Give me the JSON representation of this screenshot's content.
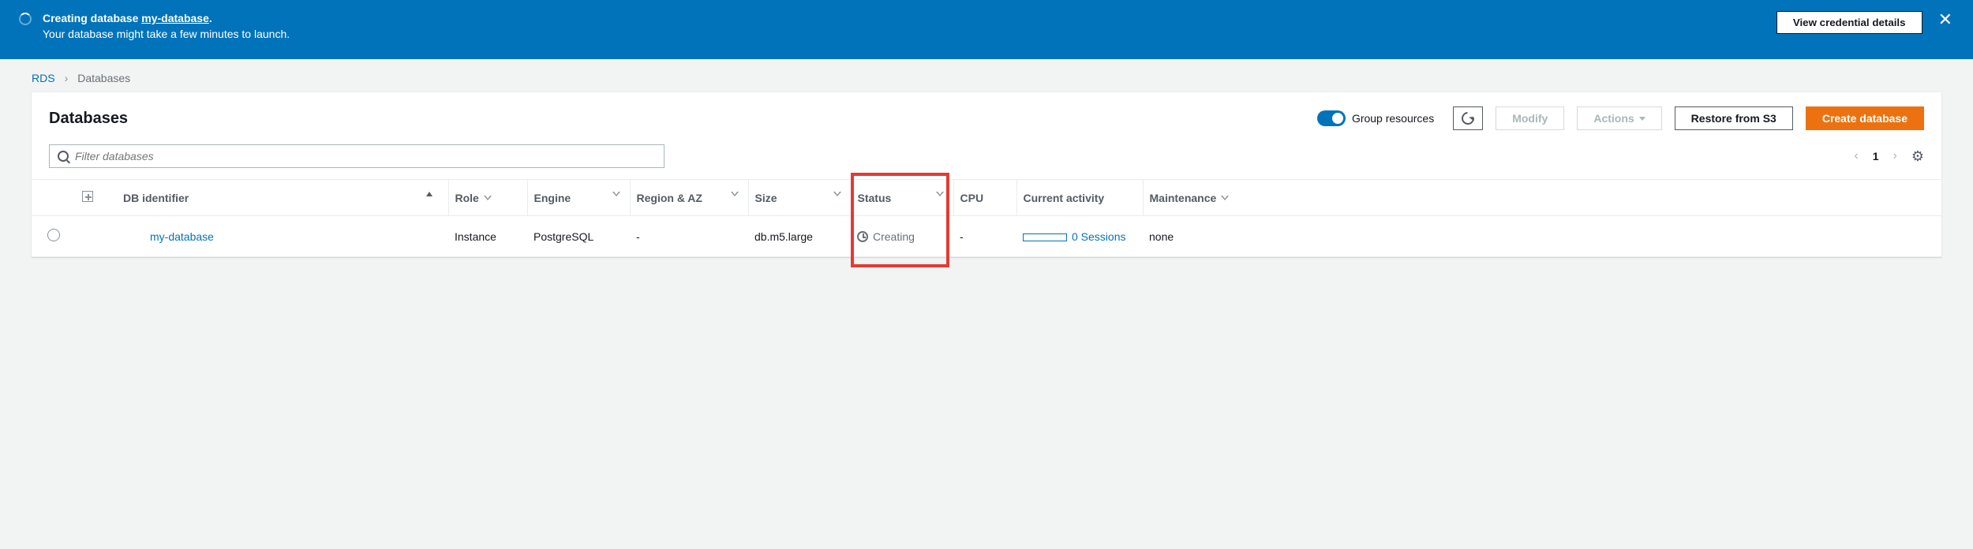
{
  "notification": {
    "line1_prefix": "Creating database ",
    "db_link": "my-database",
    "line1_suffix": ".",
    "line2": "Your database might take a few minutes to launch.",
    "view_credentials": "View credential details"
  },
  "breadcrumb": {
    "root": "RDS",
    "current": "Databases"
  },
  "panel": {
    "title": "Databases",
    "toggle_label": "Group resources",
    "modify": "Modify",
    "actions": "Actions",
    "restore": "Restore from S3",
    "create": "Create database",
    "filter_placeholder": "Filter databases",
    "page": "1"
  },
  "columns": {
    "identifier": "DB identifier",
    "role": "Role",
    "engine": "Engine",
    "region": "Region & AZ",
    "size": "Size",
    "status": "Status",
    "cpu": "CPU",
    "activity": "Current activity",
    "maintenance": "Maintenance"
  },
  "row": {
    "identifier": "my-database",
    "role": "Instance",
    "engine": "PostgreSQL",
    "region": "-",
    "size": "db.m5.large",
    "status": "Creating",
    "cpu": "-",
    "activity": "0 Sessions",
    "maintenance": "none"
  }
}
